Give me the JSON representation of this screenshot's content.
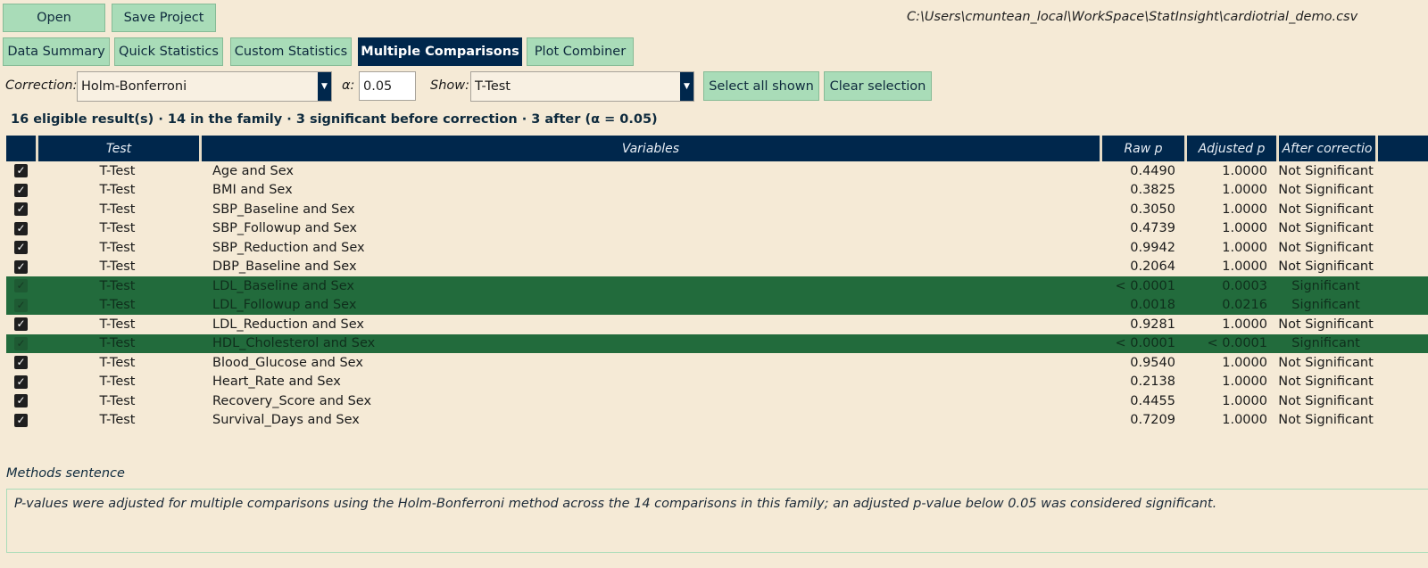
{
  "toolbar": {
    "open_label": "Open",
    "save_label": "Save Project"
  },
  "file_path": "C:\\Users\\cmuntean_local\\WorkSpace\\StatInsight\\cardiotrial_demo.csv",
  "tabs": [
    {
      "label": "Data Summary",
      "active": false
    },
    {
      "label": "Quick Statistics",
      "active": false
    },
    {
      "label": "Custom Statistics",
      "active": false
    },
    {
      "label": "Multiple Comparisons",
      "active": true
    },
    {
      "label": "Plot Combiner",
      "active": false
    }
  ],
  "controls": {
    "correction_label": "Correction:",
    "correction_value": "Holm-Bonferroni",
    "alpha_label": "α:",
    "alpha_value": "0.05",
    "show_label": "Show:",
    "show_value": "T-Test",
    "select_all_label": "Select all shown",
    "clear_label": "Clear selection"
  },
  "summary": "16 eligible result(s) · 14 in the family · 3 significant before correction · 3 after (α = 0.05)",
  "table": {
    "columns": [
      "",
      "Test",
      "Variables",
      "Raw p",
      "Adjusted p",
      "After correctio"
    ],
    "rows": [
      {
        "checked": true,
        "test": "T-Test",
        "variables": "Age and Sex",
        "raw_p": "0.4490",
        "adj_p": "1.0000",
        "result": "Not Significant",
        "significant": false
      },
      {
        "checked": true,
        "test": "T-Test",
        "variables": "BMI and Sex",
        "raw_p": "0.3825",
        "adj_p": "1.0000",
        "result": "Not Significant",
        "significant": false
      },
      {
        "checked": true,
        "test": "T-Test",
        "variables": "SBP_Baseline and Sex",
        "raw_p": "0.3050",
        "adj_p": "1.0000",
        "result": "Not Significant",
        "significant": false
      },
      {
        "checked": true,
        "test": "T-Test",
        "variables": "SBP_Followup and Sex",
        "raw_p": "0.4739",
        "adj_p": "1.0000",
        "result": "Not Significant",
        "significant": false
      },
      {
        "checked": true,
        "test": "T-Test",
        "variables": "SBP_Reduction and Sex",
        "raw_p": "0.9942",
        "adj_p": "1.0000",
        "result": "Not Significant",
        "significant": false
      },
      {
        "checked": true,
        "test": "T-Test",
        "variables": "DBP_Baseline and Sex",
        "raw_p": "0.2064",
        "adj_p": "1.0000",
        "result": "Not Significant",
        "significant": false
      },
      {
        "checked": true,
        "test": "T-Test",
        "variables": "LDL_Baseline and Sex",
        "raw_p": "< 0.0001",
        "adj_p": "0.0003",
        "result": "Significant",
        "significant": true
      },
      {
        "checked": true,
        "test": "T-Test",
        "variables": "LDL_Followup and Sex",
        "raw_p": "0.0018",
        "adj_p": "0.0216",
        "result": "Significant",
        "significant": true
      },
      {
        "checked": true,
        "test": "T-Test",
        "variables": "LDL_Reduction and Sex",
        "raw_p": "0.9281",
        "adj_p": "1.0000",
        "result": "Not Significant",
        "significant": false
      },
      {
        "checked": true,
        "test": "T-Test",
        "variables": "HDL_Cholesterol and Sex",
        "raw_p": "< 0.0001",
        "adj_p": "< 0.0001",
        "result": "Significant",
        "significant": true
      },
      {
        "checked": true,
        "test": "T-Test",
        "variables": "Blood_Glucose and Sex",
        "raw_p": "0.9540",
        "adj_p": "1.0000",
        "result": "Not Significant",
        "significant": false
      },
      {
        "checked": true,
        "test": "T-Test",
        "variables": "Heart_Rate and Sex",
        "raw_p": "0.2138",
        "adj_p": "1.0000",
        "result": "Not Significant",
        "significant": false
      },
      {
        "checked": true,
        "test": "T-Test",
        "variables": "Recovery_Score and Sex",
        "raw_p": "0.4455",
        "adj_p": "1.0000",
        "result": "Not Significant",
        "significant": false
      },
      {
        "checked": true,
        "test": "T-Test",
        "variables": "Survival_Days and Sex",
        "raw_p": "0.7209",
        "adj_p": "1.0000",
        "result": "Not Significant",
        "significant": false
      }
    ]
  },
  "methods": {
    "label": "Methods sentence",
    "text": "P-values were adjusted for multiple comparisons using the Holm-Bonferroni method across the 14 comparisons in this family; an adjusted p-value below 0.05 was considered significant."
  },
  "colors": {
    "header_bg": "#00274c",
    "significant_row": "#226b3c",
    "button_bg": "#a9dcb8",
    "page_bg": "#f5ead6"
  }
}
